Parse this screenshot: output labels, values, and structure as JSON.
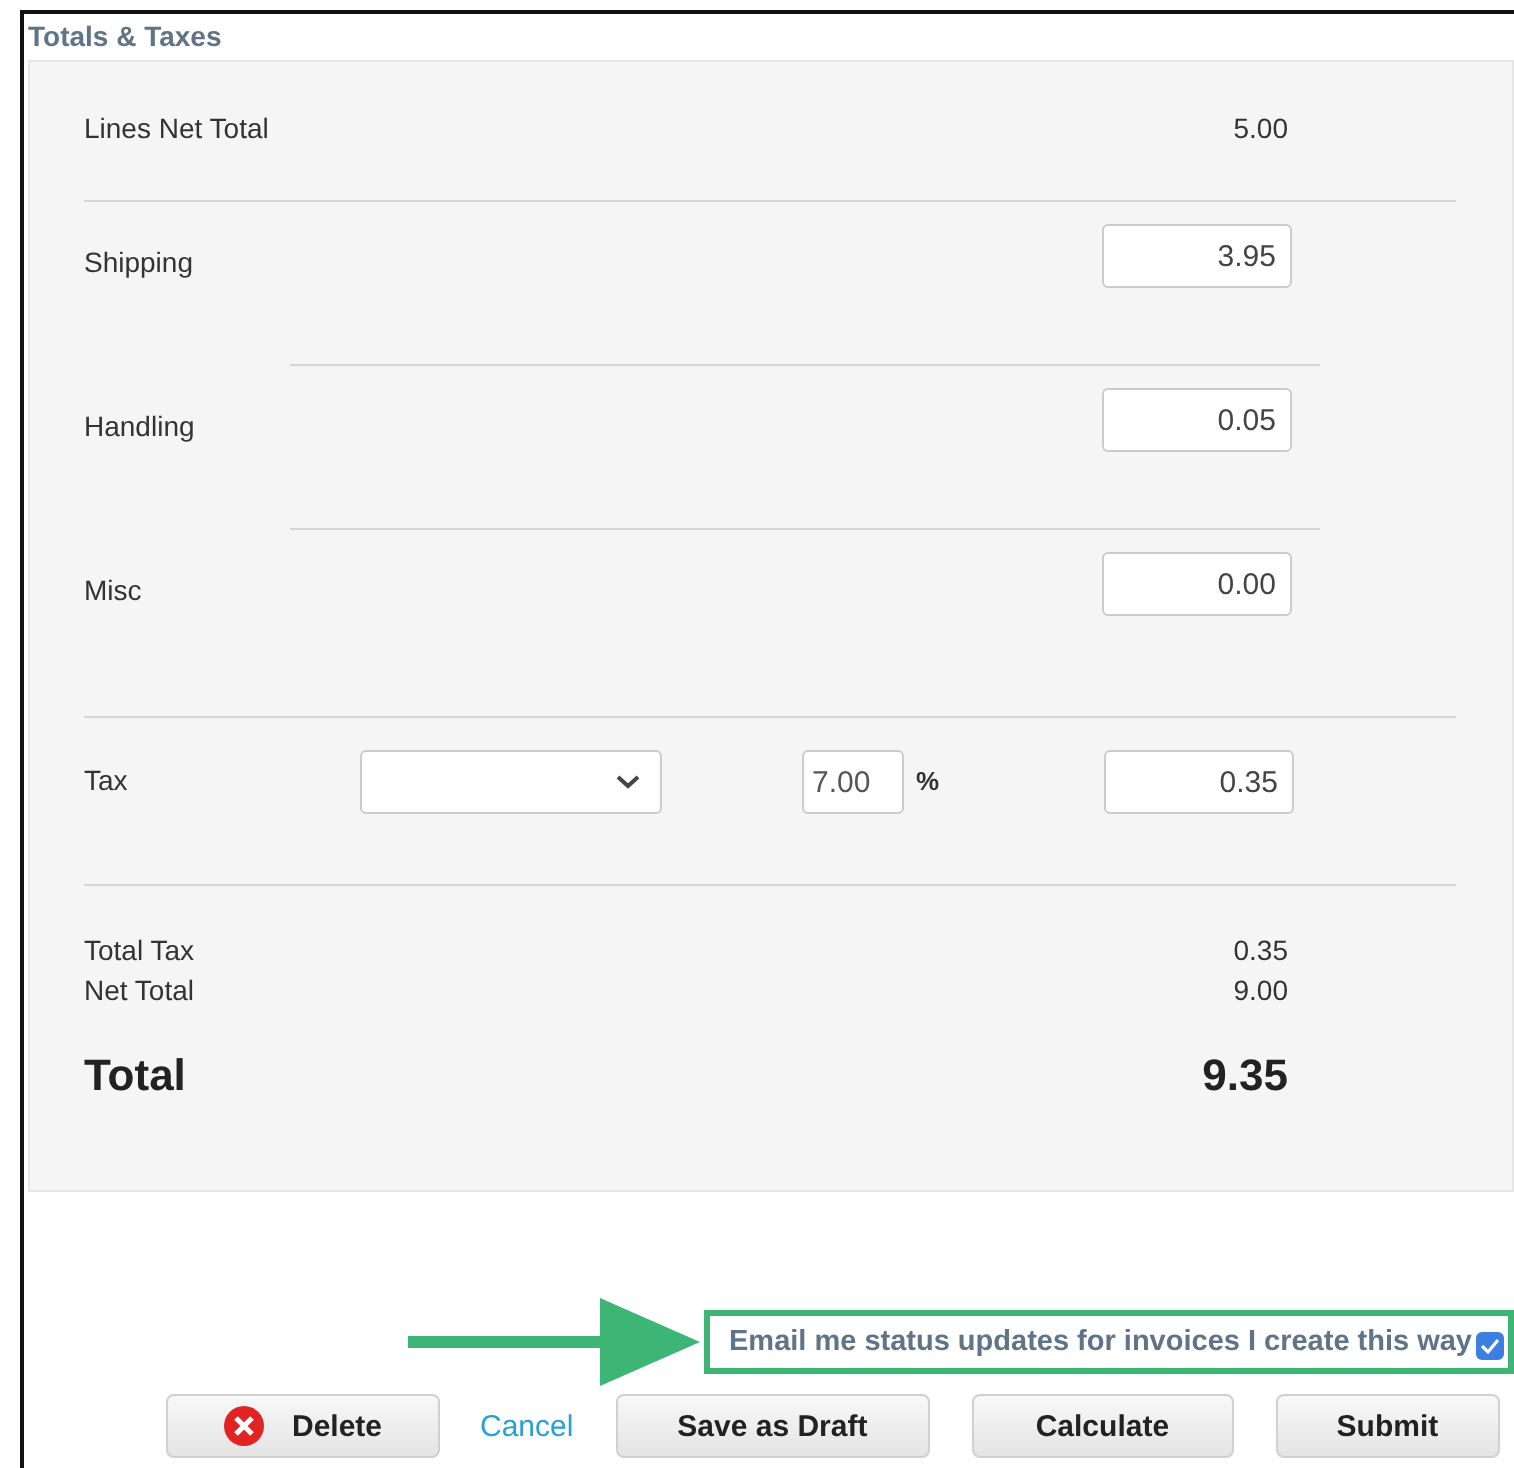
{
  "section": {
    "title": "Totals & Taxes"
  },
  "rows": [
    {
      "kind": "value",
      "label": "Lines Net Total",
      "value": "5.00",
      "rule_after": true,
      "rule_indented": false
    },
    {
      "kind": "input",
      "label": "Shipping",
      "value": "3.95",
      "rule_after": true,
      "rule_indented": true
    },
    {
      "kind": "input",
      "label": "Handling",
      "value": "0.05",
      "rule_after": true,
      "rule_indented": true
    },
    {
      "kind": "input",
      "label": "Misc",
      "value": "0.00",
      "rule_after": true,
      "rule_indented": false
    },
    {
      "kind": "tax",
      "label": "Tax",
      "rate": "7.00",
      "unit": "%",
      "value": "0.35",
      "rule_after": true,
      "rule_indented": false
    },
    {
      "kind": "summary",
      "label": "Total Tax",
      "value": "0.35"
    },
    {
      "kind": "summary",
      "label": "Net Total",
      "value": "9.00"
    },
    {
      "kind": "grand",
      "label": "Total",
      "value": "9.35"
    }
  ],
  "email_option": {
    "label": "Email me status updates for invoices I create this way",
    "checked": true,
    "highlighted": true
  },
  "buttons": [
    {
      "kind": "delete",
      "label": "Delete"
    },
    {
      "kind": "link",
      "label": "Cancel"
    },
    {
      "kind": "plain",
      "label": "Save as Draft"
    },
    {
      "kind": "plain",
      "label": "Calculate"
    },
    {
      "kind": "plain",
      "label": "Submit"
    }
  ]
}
